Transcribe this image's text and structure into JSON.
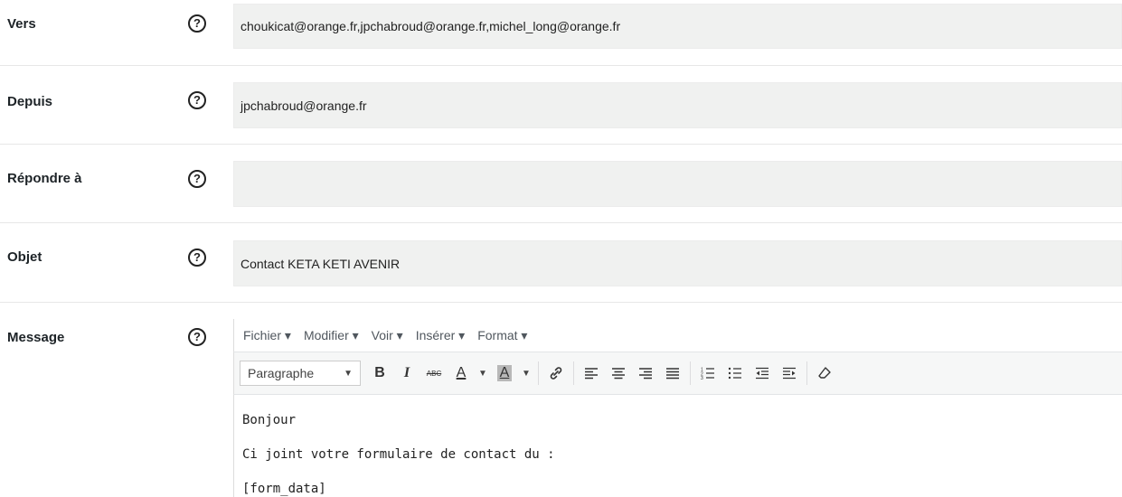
{
  "fields": {
    "to": {
      "label": "Vers",
      "value": "choukicat@orange.fr,jpchabroud@orange.fr,michel_long@orange.fr"
    },
    "from": {
      "label": "Depuis",
      "value": "jpchabroud@orange.fr"
    },
    "reply_to": {
      "label": "Répondre à",
      "value": ""
    },
    "subject": {
      "label": "Objet",
      "value": "Contact KETA KETI AVENIR"
    },
    "message": {
      "label": "Message"
    }
  },
  "help_glyph": "?",
  "editor": {
    "menus": [
      "Fichier ▾",
      "Modifier ▾",
      "Voir ▾",
      "Insérer ▾",
      "Format ▾"
    ],
    "format_select": "Paragraphe",
    "content": [
      "Bonjour",
      "Ci joint votre formulaire de contact du :",
      "[form_data]"
    ]
  }
}
